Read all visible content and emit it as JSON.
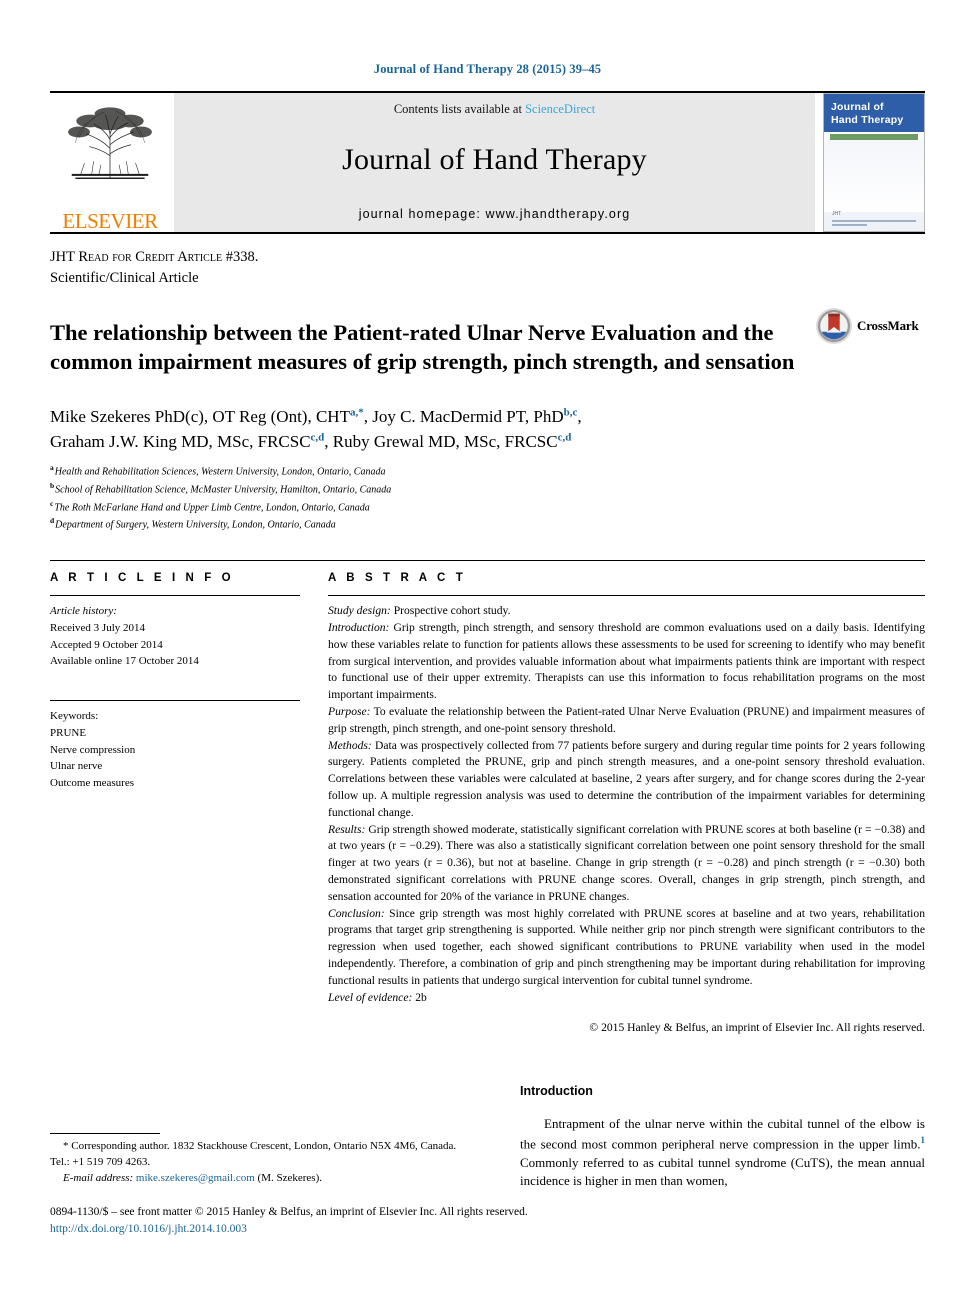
{
  "running_head": "Journal of Hand Therapy 28 (2015) 39–45",
  "masthead": {
    "contents_prefix": "Contents lists available at ",
    "sciencedirect": "ScienceDirect",
    "journal_name": "Journal of Hand Therapy",
    "homepage": "journal homepage: www.jhandtherapy.org",
    "publisher": "ELSEVIER",
    "cover_title_line1": "Journal of",
    "cover_title_line2": "Hand Therapy",
    "cover_footer_label": "JHT"
  },
  "article_type": {
    "line1_prefix": "JHT ",
    "line1_caps": "Read for Credit Article #338.",
    "line2": "Scientific/Clinical Article"
  },
  "title": "The relationship between the Patient-rated Ulnar Nerve Evaluation and the common impairment measures of grip strength, pinch strength, and sensation",
  "crossmark": {
    "label": "CrossMark"
  },
  "authors": {
    "line1_a": "Mike Szekeres PhD(c), OT Reg (Ont), CHT",
    "line1_mark1": "a,*",
    "line1_b": ", Joy C. MacDermid PT, PhD",
    "line1_mark2": "b,c",
    "line1_c": ",",
    "line2_a": "Graham J.W. King MD, MSc, FRCSC",
    "line2_mark1": "c,d",
    "line2_b": ", Ruby Grewal MD, MSc, FRCSC",
    "line2_mark2": "c,d"
  },
  "affiliations": [
    {
      "letter": "a",
      "text": "Health and Rehabilitation Sciences, Western University, London, Ontario, Canada"
    },
    {
      "letter": "b",
      "text": "School of Rehabilitation Science, McMaster University, Hamilton, Ontario, Canada"
    },
    {
      "letter": "c",
      "text": "The Roth McFarlane Hand and Upper Limb Centre, London, Ontario, Canada"
    },
    {
      "letter": "d",
      "text": "Department of Surgery, Western University, London, Ontario, Canada"
    }
  ],
  "article_info": {
    "heading": "A R T I C L E  I N F O",
    "history_label": "Article history:",
    "received": "Received 3 July 2014",
    "accepted": "Accepted 9 October 2014",
    "available": "Available online 17 October 2014",
    "keywords_label": "Keywords:",
    "keywords": [
      "PRUNE",
      "Nerve compression",
      "Ulnar nerve",
      "Outcome measures"
    ]
  },
  "abstract": {
    "heading": "A B S T R A C T",
    "study_design_label": "Study design:",
    "study_design_text": " Prospective cohort study.",
    "introduction_label": "Introduction:",
    "introduction_text": " Grip strength, pinch strength, and sensory threshold are common evaluations used on a daily basis. Identifying how these variables relate to function for patients allows these assessments to be used for screening to identify who may benefit from surgical intervention, and provides valuable information about what impairments patients think are important with respect to functional use of their upper extremity. Therapists can use this information to focus rehabilitation programs on the most important impairments.",
    "purpose_label": "Purpose:",
    "purpose_text": " To evaluate the relationship between the Patient-rated Ulnar Nerve Evaluation (PRUNE) and impairment measures of grip strength, pinch strength, and one-point sensory threshold.",
    "methods_label": "Methods:",
    "methods_text": " Data was prospectively collected from 77 patients before surgery and during regular time points for 2 years following surgery. Patients completed the PRUNE, grip and pinch strength measures, and a one-point sensory threshold evaluation. Correlations between these variables were calculated at baseline, 2 years after surgery, and for change scores during the 2-year follow up. A multiple regression analysis was used to determine the contribution of the impairment variables for determining functional change.",
    "results_label": "Results:",
    "results_text": " Grip strength showed moderate, statistically significant correlation with PRUNE scores at both baseline (r = −0.38) and at two years (r = −0.29). There was also a statistically significant correlation between one point sensory threshold for the small finger at two years (r = 0.36), but not at baseline. Change in grip strength (r = −0.28) and pinch strength (r = −0.30) both demonstrated significant correlations with PRUNE change scores. Overall, changes in grip strength, pinch strength, and sensation accounted for 20% of the variance in PRUNE changes.",
    "conclusion_label": "Conclusion:",
    "conclusion_text": " Since grip strength was most highly correlated with PRUNE scores at baseline and at two years, rehabilitation programs that target grip strengthening is supported. While neither grip nor pinch strength were significant contributors to the regression when used together, each showed significant contributions to PRUNE variability when used in the model independently. Therefore, a combination of grip and pinch strengthening may be important during rehabilitation for improving functional results in patients that undergo surgical intervention for cubital tunnel syndrome.",
    "level_label": "Level of evidence:",
    "level_text": " 2b",
    "copyright": "© 2015 Hanley & Belfus, an imprint of Elsevier Inc. All rights reserved."
  },
  "introduction": {
    "heading": "Introduction",
    "para1_a": "Entrapment of the ulnar nerve within the cubital tunnel of the elbow is the second most common peripheral nerve compression in the upper limb.",
    "para1_ref": "1",
    "para1_b": " Commonly referred to as cubital tunnel syndrome (CuTS), the mean annual incidence is higher in men than women,"
  },
  "footnotes": {
    "corresponding": "* Corresponding author. 1832 Stackhouse Crescent, London, Ontario N5X 4M6, Canada. Tel.: +1 519 709 4263.",
    "email_label": "E-mail address:",
    "email": "mike.szekeres@gmail.com",
    "email_suffix": " (M. Szekeres)."
  },
  "page_footer": {
    "issn_line": "0894-1130/$ – see front matter © 2015 Hanley & Belfus, an imprint of Elsevier Inc. All rights reserved.",
    "doi": "http://dx.doi.org/10.1016/j.jht.2014.10.003"
  },
  "colors": {
    "link_blue": "#1a6496",
    "sciencedirect_blue": "#3aa5dc",
    "elsevier_orange": "#f07d00",
    "cover_blue": "#2e5ea8"
  }
}
